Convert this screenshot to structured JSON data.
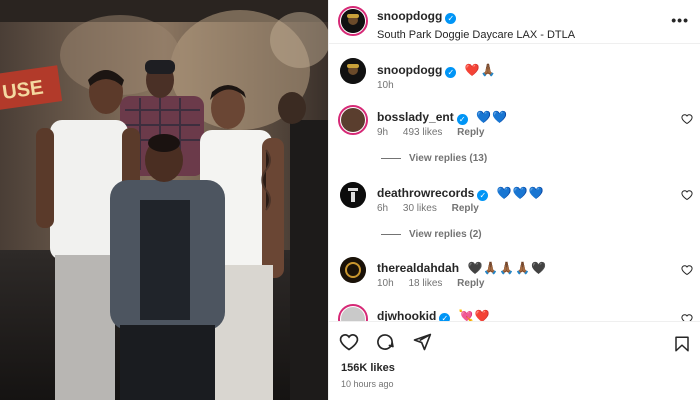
{
  "post": {
    "author": "snoopdogg",
    "location": "South Park Doggie Daycare LAX - DTLA",
    "caption_emoji": "❤️🙏🏾",
    "caption_time": "10h",
    "likes": "156K likes",
    "posted_ago": "10 hours ago"
  },
  "comments": [
    {
      "user": "bosslady_ent",
      "verified": true,
      "emoji": "💙💙",
      "time": "9h",
      "likes": "493 likes",
      "reply_label": "Reply",
      "view_replies": "View replies (13)"
    },
    {
      "user": "deathrowrecords",
      "verified": true,
      "emoji": "💙💙💙",
      "time": "6h",
      "likes": "30 likes",
      "reply_label": "Reply",
      "view_replies": "View replies (2)"
    },
    {
      "user": "therealdahdah",
      "verified": false,
      "emoji": "🖤🙏🏾🙏🏾🙏🏾🖤",
      "time": "10h",
      "likes": "18 likes",
      "reply_label": "Reply"
    },
    {
      "user": "djwhookid",
      "verified": true,
      "emoji": "💘❤️"
    }
  ],
  "icons": {
    "verified": "verified-badge-icon",
    "like": "heart-outline-icon",
    "comment": "comment-bubble-icon",
    "share": "paper-plane-icon",
    "save": "bookmark-icon"
  },
  "colors": {
    "verified_blue": "#0095f6",
    "story_ring": "#d62976",
    "muted_text": "#737373",
    "divider": "#efefef"
  }
}
